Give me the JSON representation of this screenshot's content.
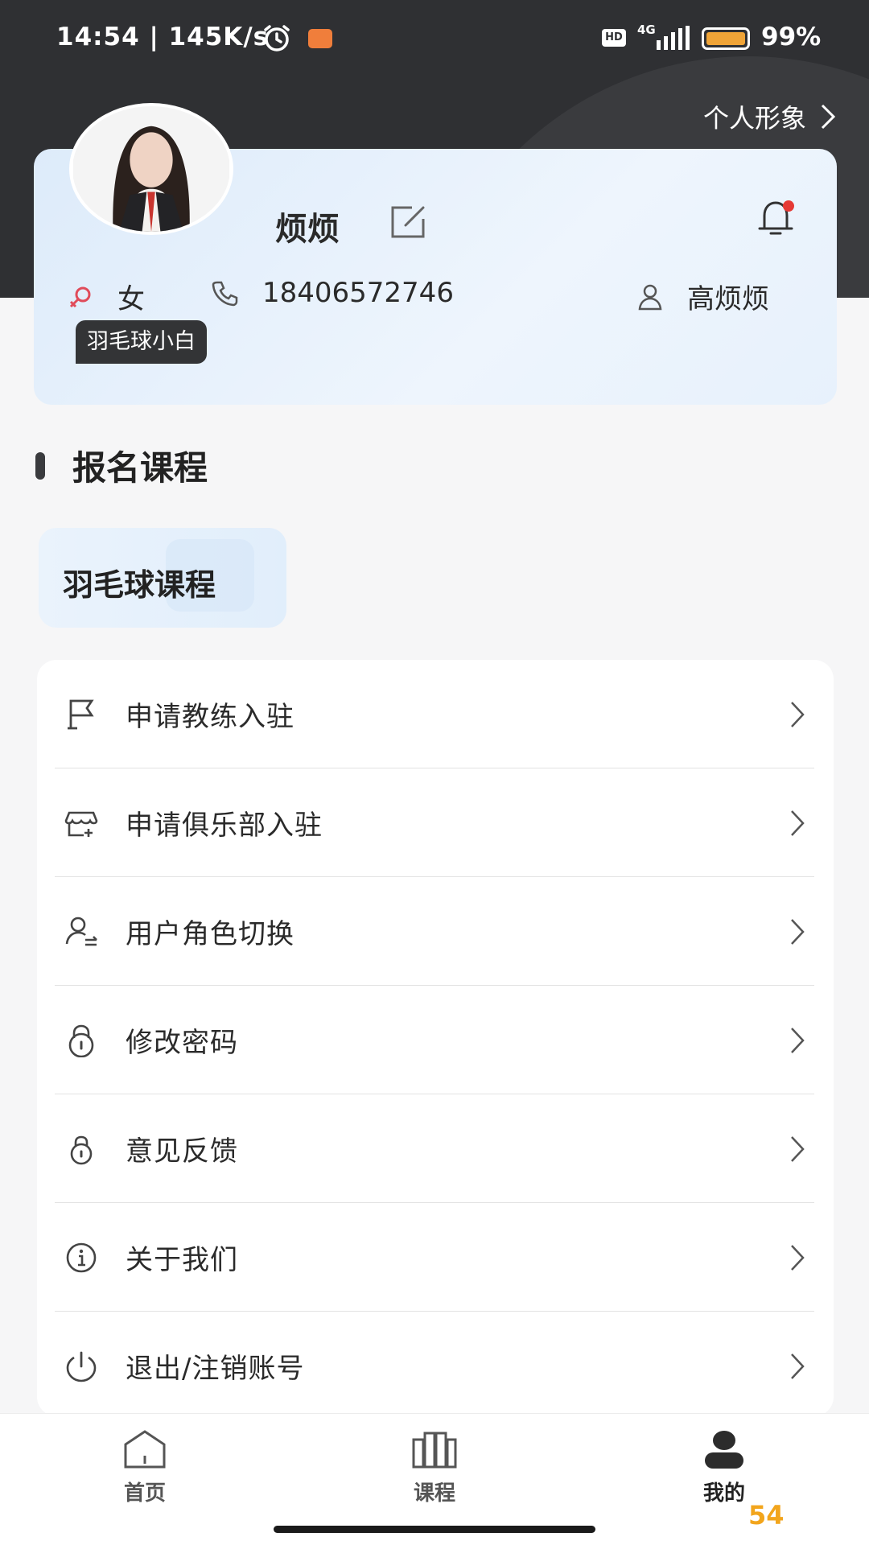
{
  "status_bar": {
    "time": "14:54 | 145K/s",
    "hd": "HD",
    "network": "4G",
    "battery_percent": "99%",
    "battery_level": 0.99,
    "app_color": "#f07e3b"
  },
  "header": {
    "persona_link": "个人形象"
  },
  "profile": {
    "name": "烦烦",
    "gender": "女",
    "phone": "18406572746",
    "real_name": "高烦烦",
    "level_tag": "羽毛球小白",
    "has_notification": true
  },
  "section": {
    "title": "报名课程"
  },
  "courses": [
    {
      "label": "羽毛球课程"
    }
  ],
  "menu": [
    {
      "label": "申请教练入驻",
      "icon": "flag-icon"
    },
    {
      "label": "申请俱乐部入驻",
      "icon": "store-icon"
    },
    {
      "label": "用户角色切换",
      "icon": "user-switch-icon"
    },
    {
      "label": "修改密码",
      "icon": "lock-icon"
    },
    {
      "label": "意见反馈",
      "icon": "feedback-icon"
    },
    {
      "label": "关于我们",
      "icon": "info-icon"
    },
    {
      "label": "退出/注销账号",
      "icon": "power-icon"
    }
  ],
  "bottom_nav": [
    {
      "label": "首页",
      "icon": "home-icon",
      "active": false
    },
    {
      "label": "课程",
      "icon": "books-icon",
      "active": false
    },
    {
      "label": "我的",
      "icon": "profile-icon",
      "active": true
    }
  ],
  "watermark": "54",
  "colors": {
    "header_bg": "#2f3033",
    "accent_red": "#e53935",
    "card_gradient": "#ddebfa"
  }
}
